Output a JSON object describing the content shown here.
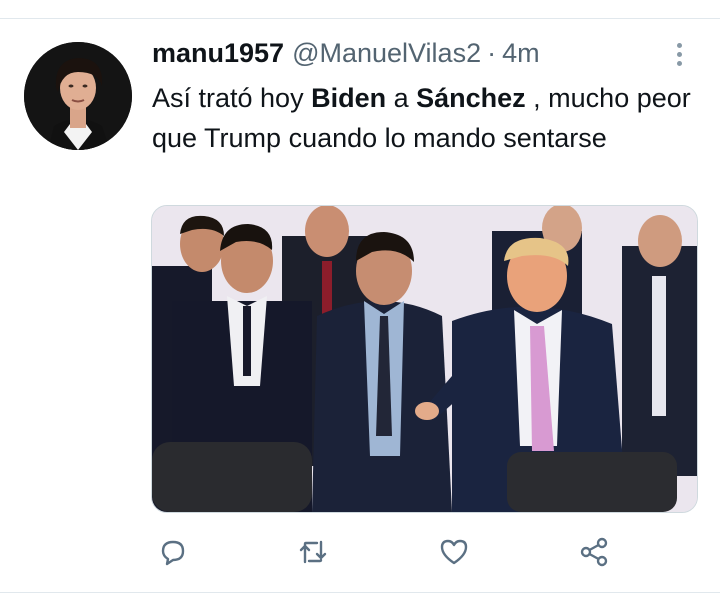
{
  "tweet": {
    "display_name": "manu1957",
    "handle": "@ManuelVilas2",
    "separator": "·",
    "time": "4m",
    "text": {
      "part1": "Así trató hoy ",
      "bold1": "Biden",
      "part2": " a ",
      "bold2": "Sánchez",
      "part3": " , mucho peor que Trump cuando lo mando sentarse"
    }
  },
  "actions": {
    "icons": [
      "reply-icon",
      "retweet-icon",
      "like-icon",
      "share-icon"
    ]
  },
  "colors": {
    "text_primary": "#0f1419",
    "text_secondary": "#536471",
    "icon_gray": "#5b7083",
    "divider": "#e1e8ed"
  }
}
